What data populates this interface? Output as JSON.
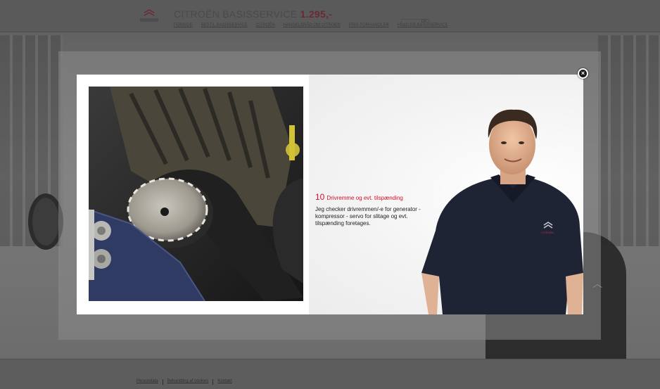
{
  "background": {
    "header_title": "CITROËN BASISSERVICE",
    "header_price": "1.295,-",
    "nav": [
      "FORSIDE",
      "BESTIL BASISSERVICE",
      "CITROËN",
      "HANDELSRÅD OM CITROËN",
      "PRIS FORHANDLER",
      "HVAD ER BASISSERVICE"
    ],
    "lang": "DK",
    "footer_links": [
      "Persondata",
      "Behandling af cookies",
      "Kontakt"
    ]
  },
  "modal": {
    "step_number": "10",
    "step_title": "Drivremme og evt. tilspænding",
    "step_description": "Jeg checker drivremmen/-e for generator - kompressor - servo for slitage og evt. tilspænding foretages.",
    "close_label": "×",
    "mechanic_badge": "CITROËN"
  },
  "colors": {
    "accent": "#d0102a",
    "overlay": "#6b6b6b",
    "modal_bg": "#ffffff"
  },
  "icons": {
    "close": "close-icon",
    "logo": "citroen-logo-icon",
    "scroll_up": "chevron-up-icon"
  }
}
